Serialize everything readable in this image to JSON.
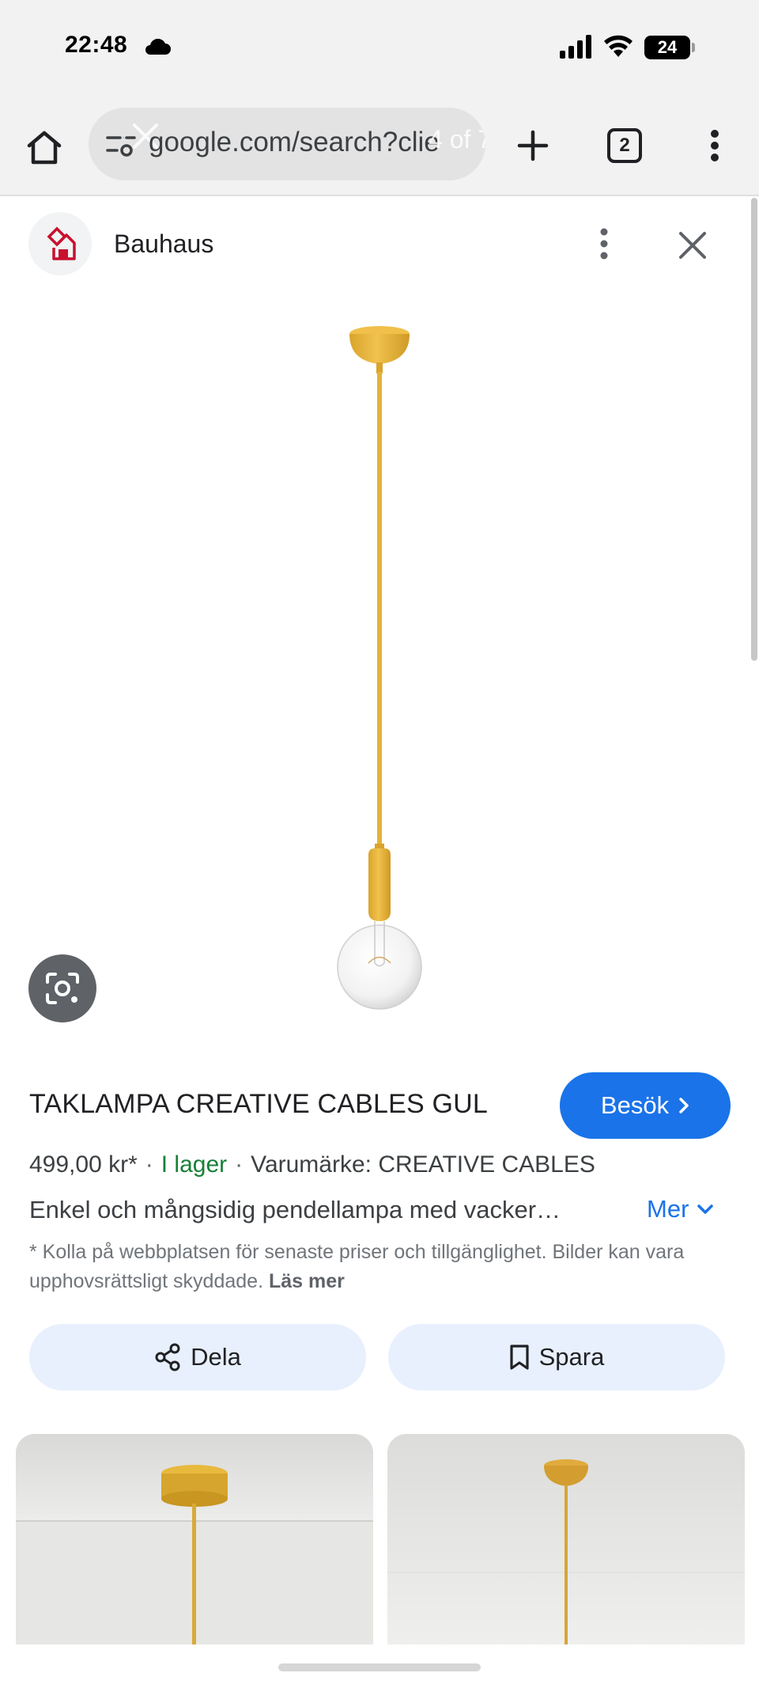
{
  "status_bar": {
    "time": "22:48",
    "battery": "24"
  },
  "browser": {
    "url": "google.com/search?clie",
    "image_counter": "4 of 7",
    "tab_count": "2"
  },
  "source": {
    "name": "Bauhaus"
  },
  "product": {
    "title": "TAKLAMPA CREATIVE CABLES GUL",
    "visit_label": "Besök",
    "price": "499,00 kr*",
    "stock": "I lager",
    "brand": "Varumärke: CREATIVE CABLES",
    "description": "Enkel och mångsidig pendellampa med vacker…",
    "more_label": "Mer",
    "disclaimer": "* Kolla på webbplatsen för senaste priser och tillgänglighet. Bilder kan vara upphovsrättsligt skyddade.",
    "read_more_label": "Läs mer"
  },
  "actions": {
    "share_label": "Dela",
    "save_label": "Spara"
  },
  "colors": {
    "accent": "#1a73e8",
    "in_stock": "#188038",
    "lamp_yellow": "#e9b740",
    "action_bg": "#e8f0fe"
  },
  "icons": [
    "home-icon",
    "tune-icon",
    "plus-icon",
    "tabs-icon",
    "more-vert-icon",
    "close-icon",
    "lens-icon",
    "chevron-right-icon",
    "chevron-down-icon",
    "share-icon",
    "bookmark-icon"
  ]
}
